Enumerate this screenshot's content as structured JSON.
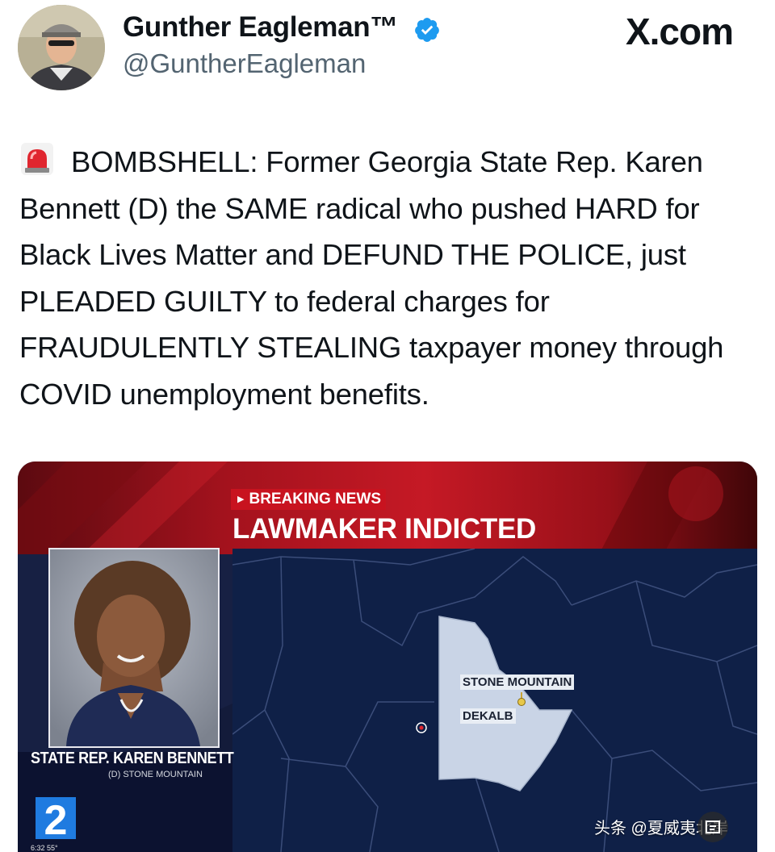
{
  "header": {
    "display_name": "Gunther Eagleman™",
    "handle": "@GuntherEagleman",
    "site": "X.com"
  },
  "tweet": {
    "emoji": "siren-emoji",
    "text": "BOMBSHELL: Former Georgia State Rep. Karen Bennett (D) the SAME radical who pushed HARD for Black Lives Matter and DEFUND THE POLICE, just PLEADED GUILTY to federal charges for FRAUDULENTLY STEALING taxpayer money through COVID unemployment benefits."
  },
  "media": {
    "banner": "BREAKING NEWS",
    "headline": "LAWMAKER INDICTED",
    "map_labels": {
      "city": "STONE MOUNTAIN",
      "county": "DEKALB"
    },
    "name_plate": "STATE REP. KAREN BENNETT",
    "name_sub": "(D) STONE MOUNTAIN",
    "channel_number": "2",
    "ticker": "6:32  55°",
    "watermark": "头条 @夏威夷北岸"
  },
  "colors": {
    "verified": "#1d9bf0",
    "breaking_red": "#c8131f",
    "map_bg": "#0f2047",
    "county_fill": "#c9d4e6"
  },
  "icons": [
    "verified-badge-icon",
    "siren-icon",
    "map-pin-icon",
    "channel-logo-icon",
    "watermark-icon"
  ]
}
